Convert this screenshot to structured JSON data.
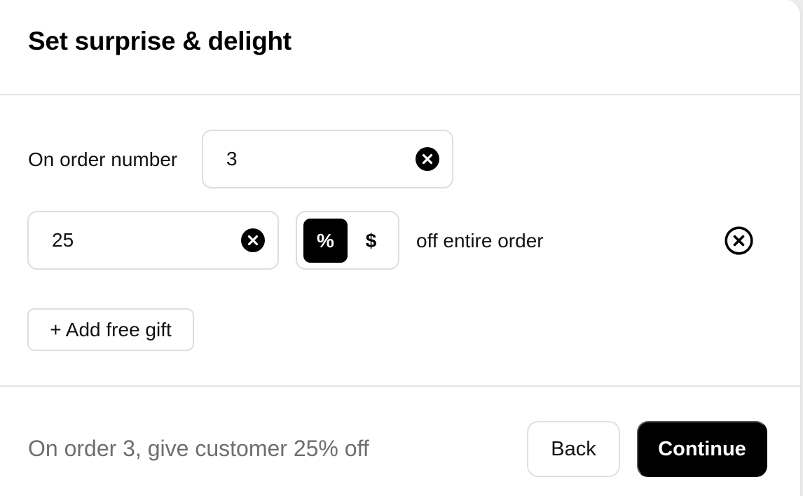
{
  "header": {
    "title": "Set surprise & delight"
  },
  "order_rule": {
    "label": "On order number",
    "value": "3"
  },
  "discount": {
    "value": "25",
    "unit_options": [
      "%",
      "$"
    ],
    "selected_unit": "%",
    "suffix": "off entire order"
  },
  "add_gift": {
    "label": "+ Add free gift"
  },
  "footer": {
    "summary": "On order 3, give customer 25% off",
    "back_label": "Back",
    "continue_label": "Continue"
  },
  "colors": {
    "primary": "#000000",
    "border": "#dedede",
    "muted_text": "#6e6e6e"
  }
}
